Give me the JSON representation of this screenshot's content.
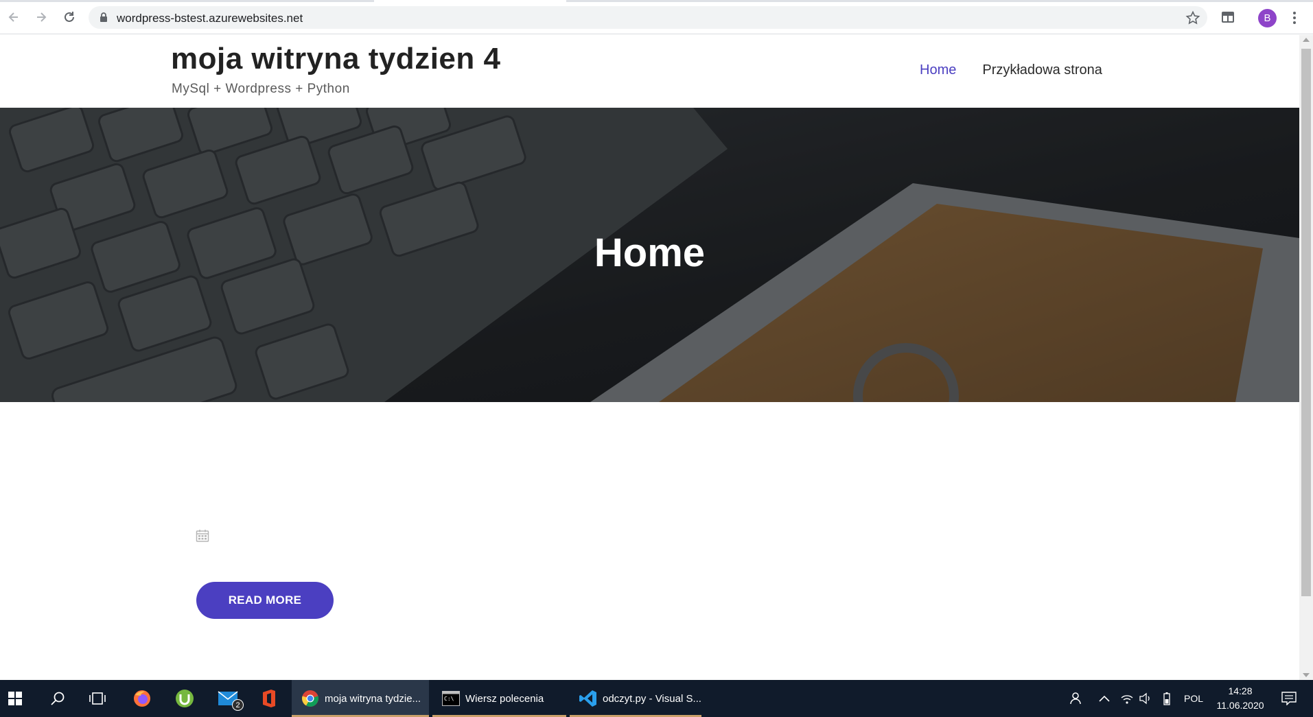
{
  "browser": {
    "url": "wordpress-bstest.azurewebsites.net",
    "profile_initial": "B"
  },
  "site": {
    "title": "moja witryna tydzien 4",
    "description": "MySql + Wordpress + Python",
    "menu": [
      {
        "label": "Home",
        "current": true
      },
      {
        "label": "Przykładowa strona",
        "current": false
      }
    ]
  },
  "hero": {
    "title": "Home"
  },
  "post": {
    "read_more_label": "READ MORE"
  },
  "colors": {
    "accent": "#4b3fc1",
    "taskbar": "#101b2b"
  },
  "taskbar": {
    "mail_badge": "2",
    "apps": [
      {
        "label": "moja witryna tydzie...",
        "icon": "chrome-icon",
        "active": true
      },
      {
        "label": "Wiersz polecenia",
        "icon": "cmd-icon",
        "active": false
      },
      {
        "label": "odczyt.py - Visual S...",
        "icon": "vscode-icon",
        "active": false
      }
    ],
    "language": "POL",
    "time": "14:28",
    "date": "11.06.2020"
  }
}
